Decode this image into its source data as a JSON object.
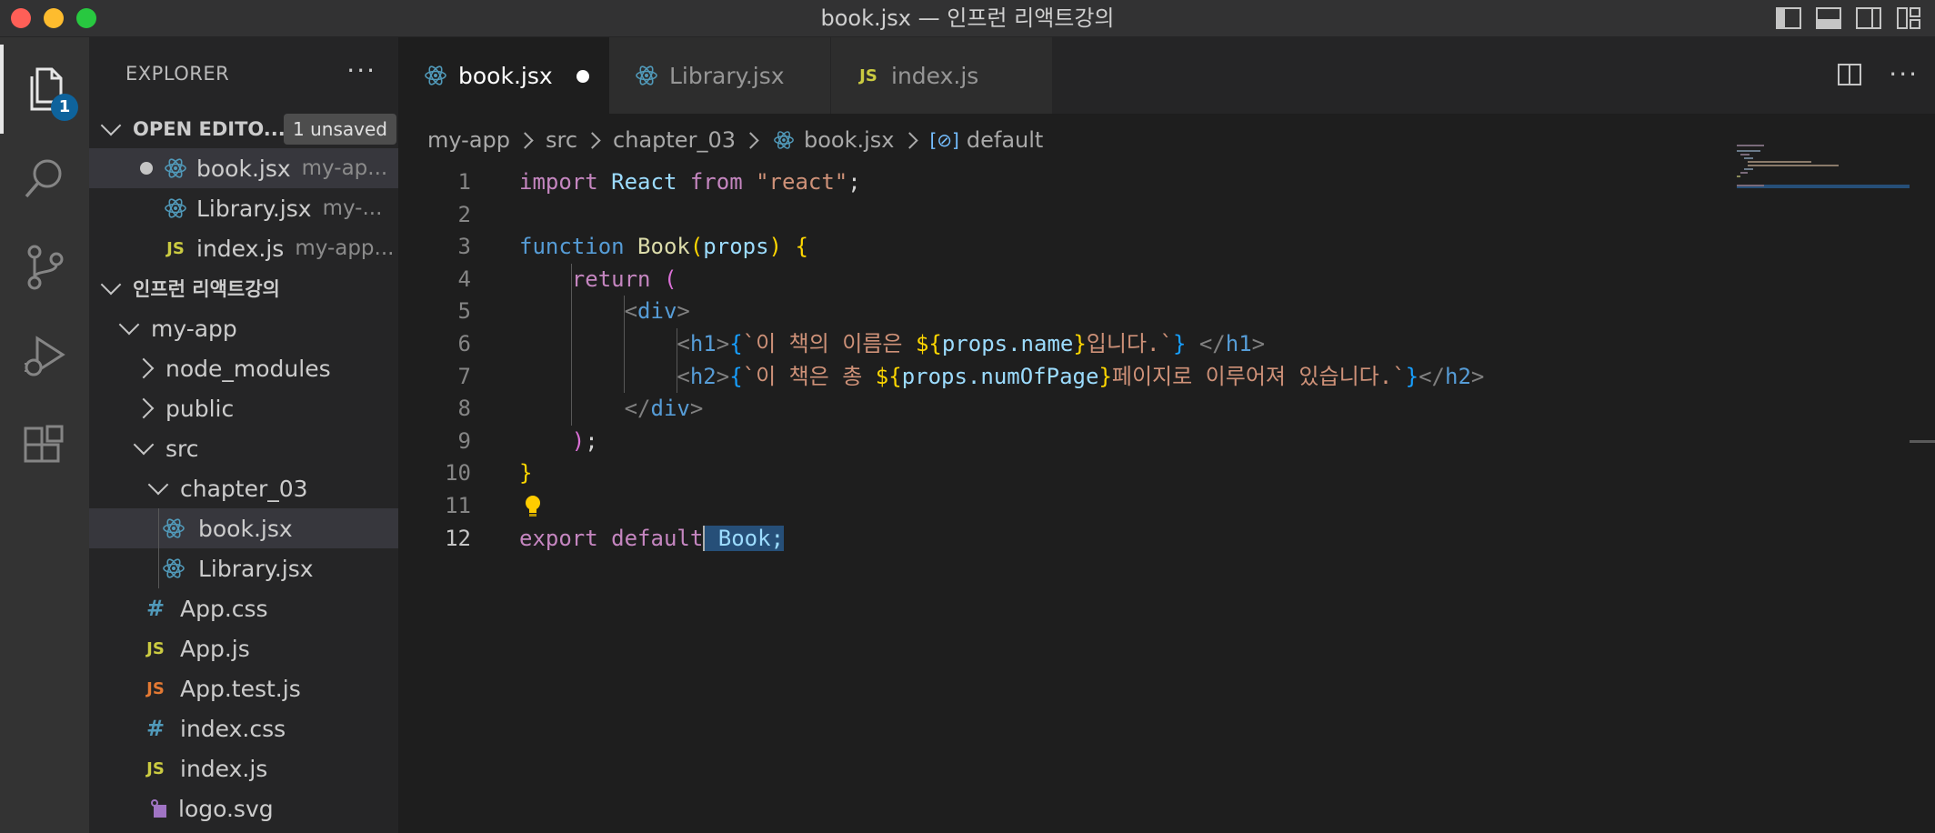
{
  "window": {
    "title": "book.jsx — 인프런 리액트강의",
    "colors": {
      "close": "#ff5f57",
      "minimize": "#febc2e",
      "maximize": "#28c840"
    }
  },
  "activity_bar": {
    "explorer_badge": "1",
    "icons": [
      "files-icon",
      "search-icon",
      "source-control-icon",
      "run-debug-icon",
      "extensions-icon"
    ]
  },
  "sidebar": {
    "title": "EXPLORER",
    "more": "···",
    "open_editors": {
      "label": "OPEN EDITO...",
      "unsaved_pill": "1 unsaved",
      "items": [
        {
          "name": "book.jsx",
          "path": "my-ap...",
          "icon": "react-icon"
        },
        {
          "name": "Library.jsx",
          "path": "my-...",
          "icon": "react-icon"
        },
        {
          "name": "index.js",
          "path": "my-app...",
          "icon": "js-icon"
        }
      ]
    },
    "workspace": {
      "label": "인프런 리액트강의",
      "my_app": "my-app",
      "node_modules": "node_modules",
      "public": "public",
      "src": "src",
      "chapter_03": "chapter_03",
      "chapter_files": [
        "book.jsx",
        "Library.jsx"
      ],
      "src_files": [
        {
          "name": "App.css",
          "icon": "css-icon"
        },
        {
          "name": "App.js",
          "icon": "js-icon"
        },
        {
          "name": "App.test.js",
          "icon": "test-js-icon"
        },
        {
          "name": "index.css",
          "icon": "css-icon"
        },
        {
          "name": "index.js",
          "icon": "js-icon"
        },
        {
          "name": "logo.svg",
          "icon": "svg-icon"
        }
      ]
    },
    "icon_glyphs": {
      "js": "JS",
      "css": "#"
    }
  },
  "tabs": [
    {
      "label": "book.jsx",
      "active": true,
      "dirty": true,
      "icon": "react-icon"
    },
    {
      "label": "Library.jsx",
      "active": false,
      "icon": "react-icon"
    },
    {
      "label": "index.js",
      "active": false,
      "icon": "js-icon"
    }
  ],
  "breadcrumb": [
    "my-app",
    "src",
    "chapter_03",
    "book.jsx",
    "default"
  ],
  "code_lines": [
    {
      "n": "1",
      "t": "import React from \"react\";"
    },
    {
      "n": "2",
      "t": ""
    },
    {
      "n": "3",
      "t": "function Book(props) {"
    },
    {
      "n": "4",
      "t": "    return ("
    },
    {
      "n": "5",
      "t": "        <div>"
    },
    {
      "n": "6",
      "t": "            <h1>{`이 책의 이름은 ${props.name}입니다.`} </h1>"
    },
    {
      "n": "7",
      "t": "            <h2>{`이 책은 총 ${props.numOfPage}페이지로 이루어져 있습니다.`}</h2>"
    },
    {
      "n": "8",
      "t": "        </div>"
    },
    {
      "n": "9",
      "t": "    );"
    },
    {
      "n": "10",
      "t": "}"
    },
    {
      "n": "11",
      "t": ""
    },
    {
      "n": "12",
      "t": "export default Book;"
    }
  ],
  "code_tokens": {
    "import": "import",
    "React": "React",
    "from": "from",
    "react_str": "\"react\"",
    "semi": ";",
    "function": "function",
    "Book": "Book",
    "props": "props",
    "return": "return",
    "div": "div",
    "h1": "h1",
    "h2": "h2",
    "h1_text1": "이 책의 이름은 ",
    "h1_expr": "props.name",
    "h1_text2": "입니다.",
    "h2_text1": "이 책은 총 ",
    "h2_expr": "props.numOfPage",
    "h2_text2": "페이지로 이루어져 있습니다.",
    "export": "export",
    "default": "default",
    "book_sel": "Book;"
  },
  "cursor_line": "12"
}
